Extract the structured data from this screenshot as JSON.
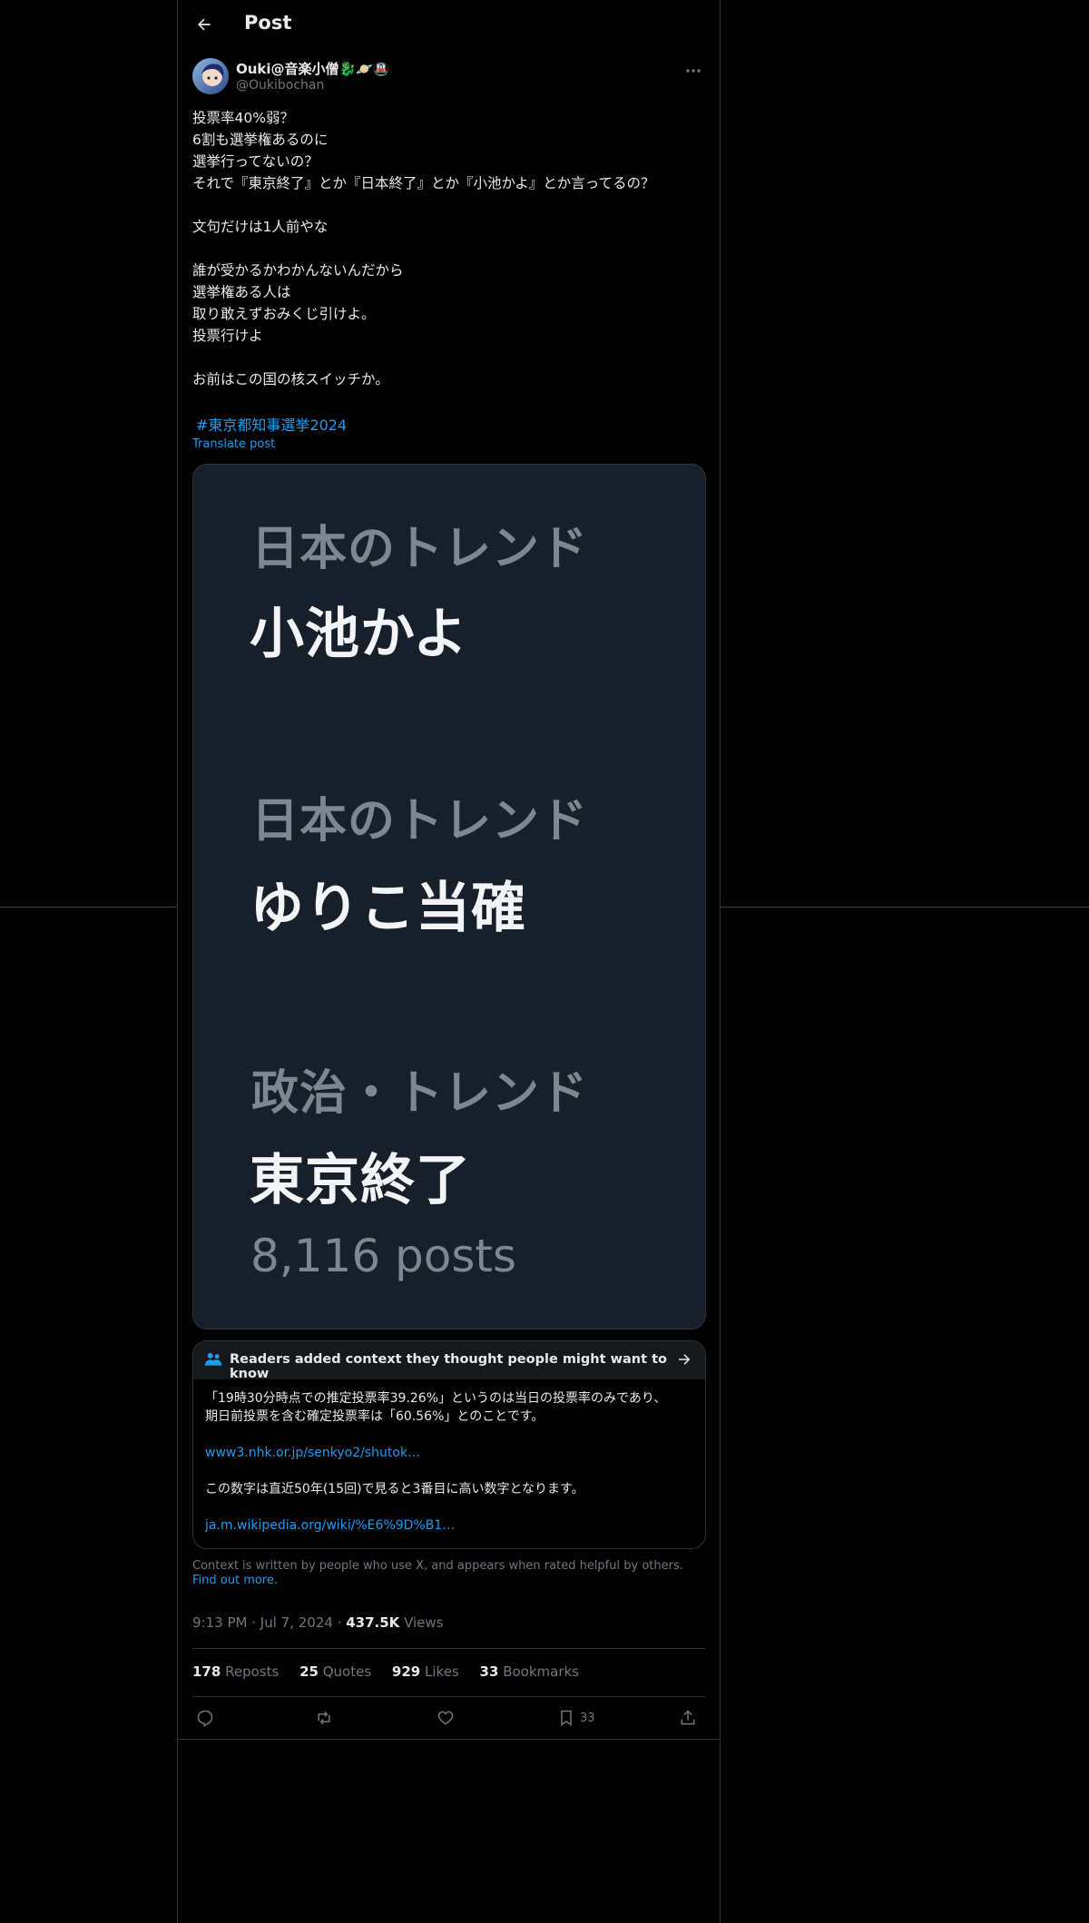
{
  "header": {
    "title": "Post",
    "back_icon": "arrow-left-icon"
  },
  "author": {
    "display_name": "Ouki@音楽小僧🐉🪐🚇",
    "handle": "@Oukibochan"
  },
  "post": {
    "lines": [
      "投票率40%弱？",
      "6割も選挙権あるのに",
      "選挙行ってないの？",
      "それで『東京終了』とか『日本終了』とか『小池かよ』とか言ってるの？",
      "",
      "文句だけは1人前やな",
      "",
      "誰が受かるかわかんないんだから",
      "選挙権ある人は",
      "取り敢えずおみくじ引けよ。",
      "投票行けよ",
      "",
      "お前はこの国の核スイッチか。"
    ],
    "hashtag": "#東京都知事選挙2024",
    "translate_label": "Translate post"
  },
  "media": {
    "trends": [
      {
        "category": "日本のトレンド",
        "name": "小池かよ",
        "count": ""
      },
      {
        "category": "日本のトレンド",
        "name": "ゆりこ当確",
        "count": ""
      },
      {
        "category": "政治・トレンド",
        "name": "東京終了",
        "count": "8,116 posts"
      }
    ]
  },
  "community_note": {
    "title": "Readers added context they thought people might want to know",
    "paragraph1_line1": "「19時30分時点での推定投票率39.26%」というのは当日の投票率のみであり、",
    "paragraph1_line2": "期日前投票を含む確定投票率は「60.56%」とのことです。",
    "link1": "www3.nhk.or.jp/senkyo2/shutok…",
    "paragraph2": "この数字は直近50年(15回)で見ると3番目に高い数字となります。",
    "link2": "ja.m.wikipedia.org/wiki/%E6%9D%B1…",
    "footer_text": "Context is written by people who use X, and appears when rated helpful by others.",
    "footer_link": "Find out more."
  },
  "meta": {
    "time": "9:13 PM",
    "date": "Jul 7, 2024",
    "views_count": "437.5K",
    "views_label": "Views"
  },
  "stats": {
    "reposts_count": "178",
    "reposts_label": "Reposts",
    "quotes_count": "25",
    "quotes_label": "Quotes",
    "likes_count": "929",
    "likes_label": "Likes",
    "bookmarks_count": "33",
    "bookmarks_label": "Bookmarks"
  },
  "actions": {
    "bookmark_count": "33"
  },
  "colors": {
    "background": "#000000",
    "text": "#e7e9ea",
    "muted": "#71767b",
    "link": "#1d9bf0",
    "border": "#2f3336",
    "media_bg": "#17202a"
  }
}
